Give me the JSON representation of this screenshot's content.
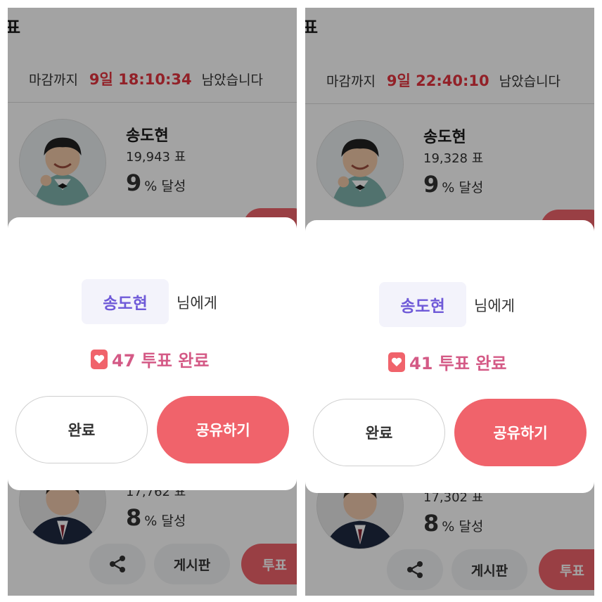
{
  "panels": [
    {
      "title_fragment": "표",
      "deadline_prefix": "마감까지",
      "deadline_time": "9일 18:10:34",
      "deadline_suffix": "남았습니다",
      "candidate1": {
        "name": "송도현",
        "votes": "19,943 표",
        "percent": "9",
        "percent_suffix": "% 달성"
      },
      "candidate2": {
        "votes_partial": "17,762 표",
        "percent": "8",
        "percent_suffix": "% 달성"
      },
      "actions": {
        "board_label": "게시판",
        "vote_label": "투표"
      },
      "modal": {
        "recipient": "송도현",
        "recipient_suffix": "님에게",
        "result": "47 투표 완료",
        "done_label": "완료",
        "share_label": "공유하기"
      }
    },
    {
      "title_fragment": "표",
      "deadline_prefix": "마감까지",
      "deadline_time": "9일 22:40:10",
      "deadline_suffix": "남았습니다",
      "candidate1": {
        "name": "송도현",
        "votes": "19,328 표",
        "percent": "9",
        "percent_suffix": "% 달성"
      },
      "candidate2": {
        "votes_partial": "17,302 표",
        "percent": "8",
        "percent_suffix": "% 달성"
      },
      "actions": {
        "board_label": "게시판",
        "vote_label": "투표"
      },
      "modal": {
        "recipient": "송도현",
        "recipient_suffix": "님에게",
        "result": "41 투표 완료",
        "done_label": "완료",
        "share_label": "공유하기"
      }
    }
  ],
  "colors": {
    "accent": "#f0636b",
    "deadline": "#e5343f",
    "recipient": "#6f5ad8",
    "result": "#d45a86"
  },
  "icons": [
    "share-icon",
    "heart-icon"
  ]
}
